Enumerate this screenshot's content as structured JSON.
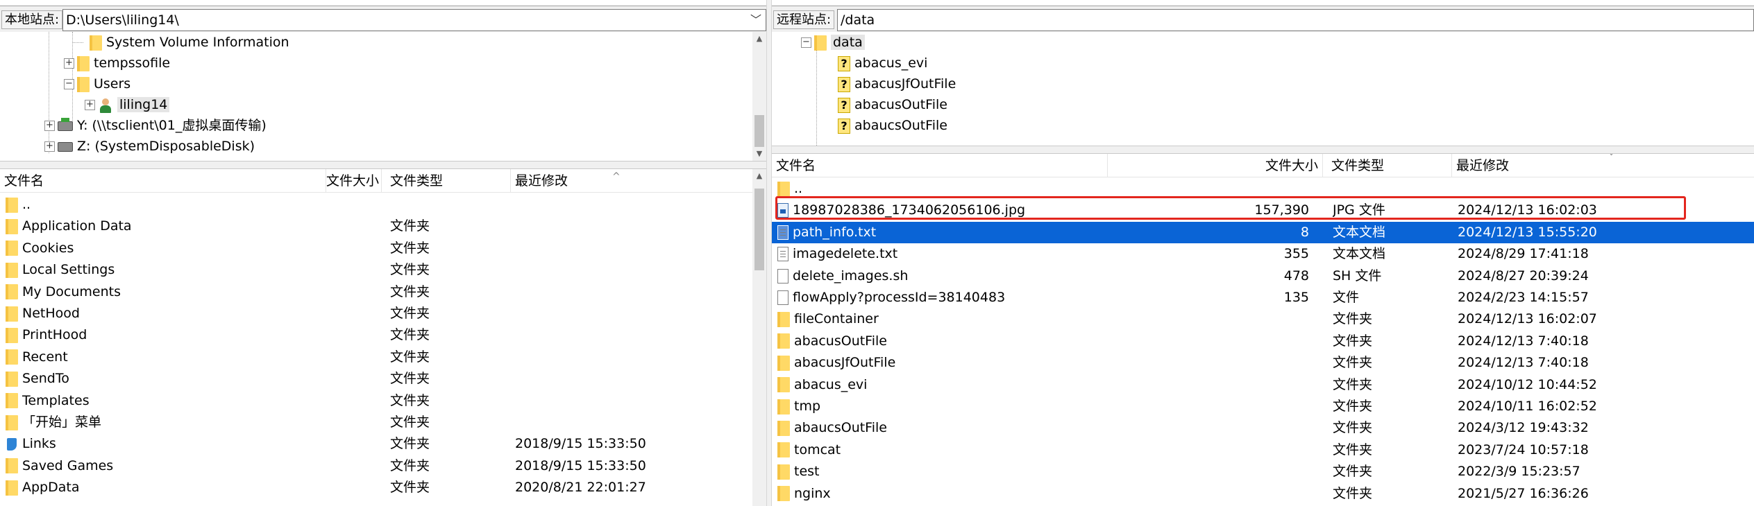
{
  "local": {
    "site_label": "本地站点:",
    "path": "D:\\Users\\liling14\\",
    "tree": [
      {
        "label": "System Volume Information",
        "icon": "folder-icon",
        "expander": ""
      },
      {
        "label": "tempssofile",
        "icon": "folder-icon",
        "expander": "+"
      },
      {
        "label": "Users",
        "icon": "folder-icon",
        "expander": "−"
      },
      {
        "label": "liling14",
        "icon": "user-icon",
        "expander": "+",
        "selected": true
      },
      {
        "label": "Y: (\\\\tsclient\\01_虚拟桌面传输)",
        "icon": "network-drive-icon",
        "expander": "+"
      },
      {
        "label": "Z: (SystemDisposableDisk)",
        "icon": "drive-icon",
        "expander": "+"
      }
    ],
    "columns": {
      "name": "文件名",
      "size": "文件大小",
      "type": "文件类型",
      "modified": "最近修改"
    },
    "files": [
      {
        "name": "..",
        "size": "",
        "type": "",
        "modified": "",
        "icon": "folder-icon"
      },
      {
        "name": "Application Data",
        "size": "",
        "type": "文件夹",
        "modified": "",
        "icon": "folder-icon"
      },
      {
        "name": "Cookies",
        "size": "",
        "type": "文件夹",
        "modified": "",
        "icon": "folder-icon"
      },
      {
        "name": "Local Settings",
        "size": "",
        "type": "文件夹",
        "modified": "",
        "icon": "folder-icon"
      },
      {
        "name": "My Documents",
        "size": "",
        "type": "文件夹",
        "modified": "",
        "icon": "folder-icon"
      },
      {
        "name": "NetHood",
        "size": "",
        "type": "文件夹",
        "modified": "",
        "icon": "folder-icon"
      },
      {
        "name": "PrintHood",
        "size": "",
        "type": "文件夹",
        "modified": "",
        "icon": "folder-icon"
      },
      {
        "name": "Recent",
        "size": "",
        "type": "文件夹",
        "modified": "",
        "icon": "folder-icon"
      },
      {
        "name": "SendTo",
        "size": "",
        "type": "文件夹",
        "modified": "",
        "icon": "folder-icon"
      },
      {
        "name": "Templates",
        "size": "",
        "type": "文件夹",
        "modified": "",
        "icon": "folder-icon"
      },
      {
        "name": "「开始」菜单",
        "size": "",
        "type": "文件夹",
        "modified": "",
        "icon": "folder-icon"
      },
      {
        "name": "Links",
        "size": "",
        "type": "文件夹",
        "modified": "2018/9/15 15:33:50",
        "icon": "link-icon"
      },
      {
        "name": "Saved Games",
        "size": "",
        "type": "文件夹",
        "modified": "2018/9/15 15:33:50",
        "icon": "folder-icon"
      },
      {
        "name": "AppData",
        "size": "",
        "type": "文件夹",
        "modified": "2020/8/21 22:01:27",
        "icon": "folder-icon"
      }
    ]
  },
  "remote": {
    "site_label": "远程站点:",
    "path": "/data",
    "tree": [
      {
        "label": "data",
        "icon": "folder-icon",
        "expander": "−",
        "selected": true
      },
      {
        "label": "abacus_evi",
        "icon": "question-icon",
        "expander": ""
      },
      {
        "label": "abacusJfOutFile",
        "icon": "question-icon",
        "expander": ""
      },
      {
        "label": "abacusOutFile",
        "icon": "question-icon",
        "expander": ""
      },
      {
        "label": "abaucsOutFile",
        "icon": "question-icon",
        "expander": ""
      }
    ],
    "columns": {
      "name": "文件名",
      "size": "文件大小",
      "type": "文件类型",
      "modified": "最近修改"
    },
    "files": [
      {
        "name": "..",
        "size": "",
        "type": "",
        "modified": "",
        "icon": "folder-icon"
      },
      {
        "name": "18987028386_1734062056106.jpg",
        "size": "157,390",
        "type": "JPG 文件",
        "modified": "2024/12/13 16:02:03",
        "icon": "image-file-icon"
      },
      {
        "name": "path_info.txt",
        "size": "8",
        "type": "文本文档",
        "modified": "2024/12/13 15:55:20",
        "icon": "text-file-icon",
        "selected": true
      },
      {
        "name": "imagedelete.txt",
        "size": "355",
        "type": "文本文档",
        "modified": "2024/8/29 17:41:18",
        "icon": "text-file-icon"
      },
      {
        "name": "delete_images.sh",
        "size": "478",
        "type": "SH 文件",
        "modified": "2024/8/27 20:39:24",
        "icon": "file-icon"
      },
      {
        "name": "flowApply?processId=38140483",
        "size": "135",
        "type": "文件",
        "modified": "2024/2/23 14:15:57",
        "icon": "file-icon"
      },
      {
        "name": "fileContainer",
        "size": "",
        "type": "文件夹",
        "modified": "2024/12/13 16:02:07",
        "icon": "folder-icon"
      },
      {
        "name": "abacusOutFile",
        "size": "",
        "type": "文件夹",
        "modified": "2024/12/13 7:40:18",
        "icon": "folder-icon"
      },
      {
        "name": "abacusJfOutFile",
        "size": "",
        "type": "文件夹",
        "modified": "2024/12/13 7:40:18",
        "icon": "folder-icon"
      },
      {
        "name": "abacus_evi",
        "size": "",
        "type": "文件夹",
        "modified": "2024/10/12 10:44:52",
        "icon": "folder-icon"
      },
      {
        "name": "tmp",
        "size": "",
        "type": "文件夹",
        "modified": "2024/10/11 16:02:52",
        "icon": "folder-icon"
      },
      {
        "name": "abaucsOutFile",
        "size": "",
        "type": "文件夹",
        "modified": "2024/3/12 19:43:32",
        "icon": "folder-icon"
      },
      {
        "name": "tomcat",
        "size": "",
        "type": "文件夹",
        "modified": "2023/7/24 10:57:18",
        "icon": "folder-icon"
      },
      {
        "name": "test",
        "size": "",
        "type": "文件夹",
        "modified": "2022/3/9 15:23:57",
        "icon": "folder-icon"
      },
      {
        "name": "nginx",
        "size": "",
        "type": "文件夹",
        "modified": "2021/5/27 16:36:26",
        "icon": "folder-icon"
      }
    ]
  },
  "colors": {
    "selection": "#0a64d6",
    "highlight_box": "#e3261e",
    "folder": "#ffd966"
  }
}
